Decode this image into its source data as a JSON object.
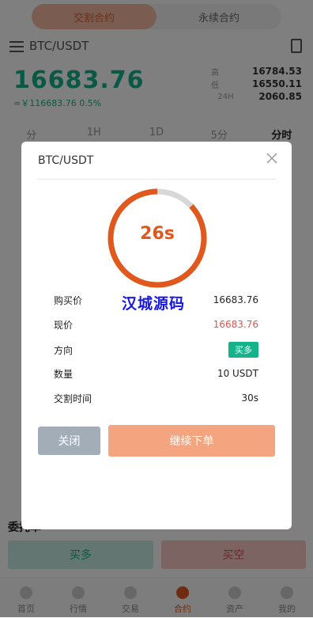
{
  "top_tabs": [
    "交割合约",
    "永续合约"
  ],
  "pair": "BTC/USDT",
  "price": {
    "last": "16683.76",
    "sub": "≈￥116683.76 0.5%"
  },
  "stats": [
    {
      "label": "高",
      "value": "16784.53"
    },
    {
      "label": "低",
      "value": "16550.11"
    },
    {
      "label": "24H",
      "value": "2060.85"
    }
  ],
  "timeframes": [
    "分",
    "1H",
    "1D",
    "5分",
    "分时"
  ],
  "bottom": {
    "entrust_label": "委托单",
    "buy_label": "买多",
    "sell_label": "买空"
  },
  "tabbar": [
    "首页",
    "行情",
    "交易",
    "合约",
    "资产",
    "我的"
  ],
  "modal": {
    "title": "BTC/USDT",
    "countdown": "26s",
    "countdown_progress": 0.87,
    "watermark": "汉城源码",
    "rows": [
      {
        "label": "购买价",
        "value": "16683.76"
      },
      {
        "label": "现价",
        "value": "16683.76"
      },
      {
        "label": "方向",
        "value": "买多"
      },
      {
        "label": "数量",
        "value": "10 USDT"
      },
      {
        "label": "交割时间",
        "value": "30s"
      }
    ],
    "close_label": "关闭",
    "continue_label": "继续下单"
  },
  "colors": {
    "accent": "#e0581c",
    "up": "#15b389",
    "down": "#d9534f"
  }
}
